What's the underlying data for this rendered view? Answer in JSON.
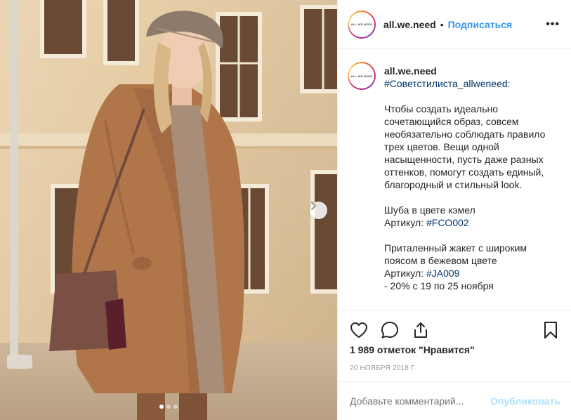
{
  "post": {
    "username": "all.we.need",
    "follow_label": "Подписаться",
    "bullet": "•",
    "more": "•••",
    "avatar_logo_text": "ALL.WE.NEED",
    "caption": {
      "hashtag_line": "#Советстилиста_allweneed:",
      "paragraph_1": "Чтобы создать идеально сочетающийся образ, совсем необязательно соблюдать правило трех цветов. Вещи одной насыщенности, пусть даже разных оттенков, помогут создать единый, благородный и стильный look.",
      "item_1_name": "Шуба в цвете кэмел",
      "item_1_article_label": "Артикул: ",
      "item_1_article_tag": "#FCO002",
      "item_2_name": "Приталенный жакет с широким поясом в бежевом цвете",
      "item_2_article_label": "Артикул: ",
      "item_2_article_tag": "#JA009",
      "item_2_discount": "- 20% с 19 по 25 ноября"
    },
    "likes": "1 989 отметок \"Нравится\"",
    "date": "20 НОЯБРЯ 2018 Г.",
    "comment_placeholder": "Добавьте комментарий...",
    "post_button": "Опубликовать"
  },
  "carousel": {
    "total_slides": 3,
    "active_slide": 1
  },
  "icons": {
    "like": "heart-icon",
    "comment": "comment-icon",
    "share": "share-icon",
    "save": "bookmark-icon",
    "next": "chevron-right-icon"
  },
  "colors": {
    "link_blue": "#3897f0",
    "hashtag": "#003569",
    "post_disabled": "#b2dffc",
    "coat": "#b0764a"
  }
}
